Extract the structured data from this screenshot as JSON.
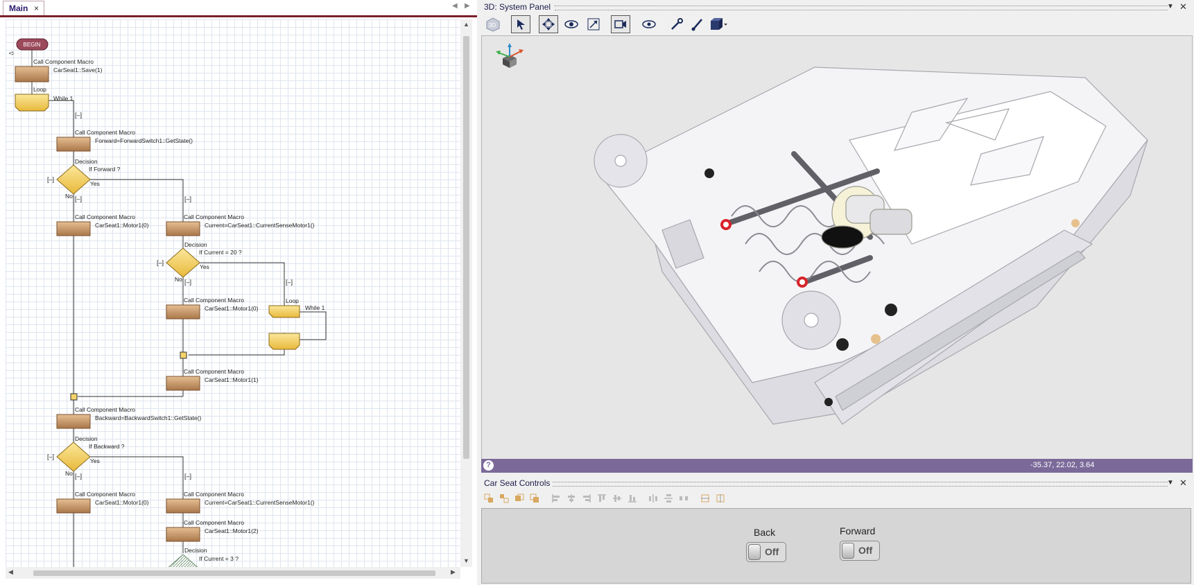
{
  "left_panel": {
    "tab_label": "Main",
    "tab_close": "×"
  },
  "flowchart": {
    "begin": "BEGIN",
    "call_macro": "Call Component Macro",
    "loop": "Loop",
    "while_1": "While 1",
    "decision": "Decision",
    "yes": "Yes",
    "no": "No",
    "collapse": "[–]",
    "save": "CarSeat1::Save(1)",
    "get_forward": "Forward=ForwardSwitch1::GetState()",
    "if_forward": "If Forward ?",
    "motor_0": "CarSeat1::Motor1(0)",
    "current_sense": "Current=CarSeat1::CurrentSenseMotor1()",
    "if_current_20": "If Current = 20 ?",
    "motor_1": "CarSeat1::Motor1(1)",
    "get_backward": "Backward=BackwardSwitch1::GetState()",
    "if_backward": "If Backward ?",
    "motor_2": "CarSeat1::Motor1(2)",
    "if_current_3": "If Current = 3 ?"
  },
  "system_panel": {
    "title": "3D: System Panel",
    "coordinates": "-35.37, 22.02, 3.64",
    "help": "?"
  },
  "car_seat_controls": {
    "title": "Car Seat Controls",
    "back_label": "Back",
    "back_state": "Off",
    "forward_label": "Forward",
    "forward_state": "Off"
  },
  "colors": {
    "tab_accent": "#7a1f2b",
    "status_bar": "#7b6a99",
    "macro_block": "#c99a6b",
    "decision_block": "#f5d36a"
  }
}
